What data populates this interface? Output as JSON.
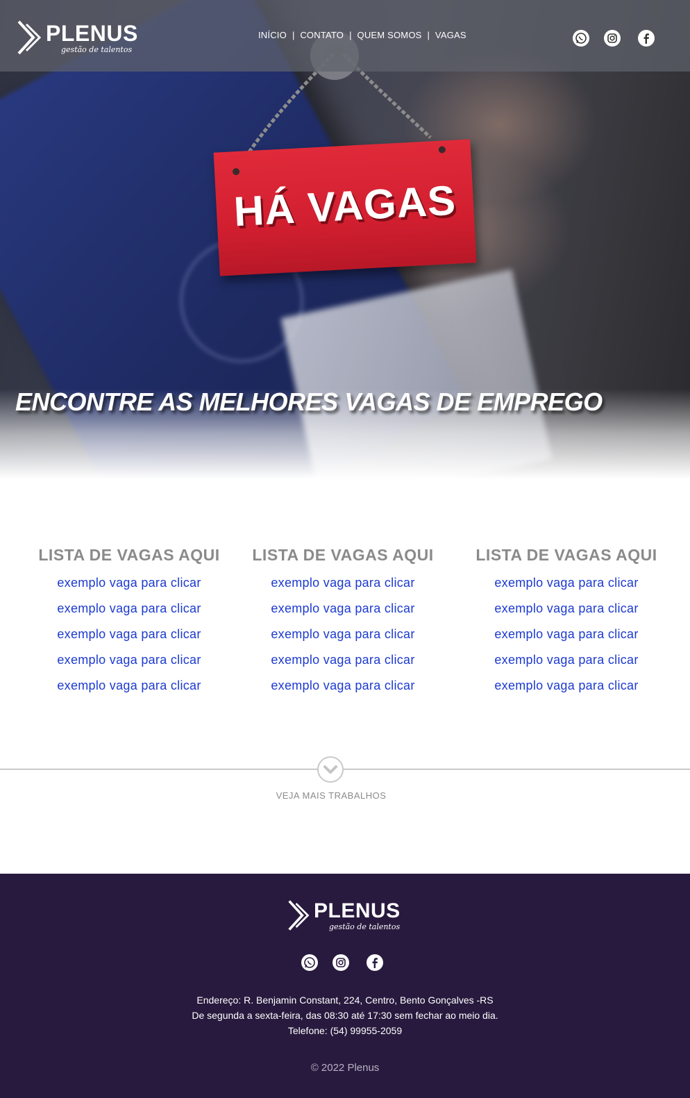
{
  "brand": {
    "name": "PLENUS",
    "tagline": "gestão de talentos"
  },
  "nav": {
    "items": [
      "INÍCIO",
      "CONTATO",
      "QUEM SOMOS",
      "VAGAS"
    ],
    "separator": "|"
  },
  "social": [
    "whatsapp-icon",
    "instagram-icon",
    "facebook-icon"
  ],
  "hero": {
    "sign_text": "HÁ VAGAS",
    "headline": "ENCONTRE AS MELHORES VAGAS DE EMPREGO"
  },
  "jobs": {
    "columns": [
      {
        "title": "LISTA DE VAGAS AQUI",
        "items": [
          "exemplo vaga para clicar",
          "exemplo vaga para clicar",
          "exemplo vaga para clicar",
          "exemplo vaga para clicar",
          "exemplo vaga para clicar"
        ]
      },
      {
        "title": "LISTA DE VAGAS AQUI",
        "items": [
          "exemplo vaga para clicar",
          "exemplo vaga para clicar",
          "exemplo vaga para clicar",
          "exemplo vaga para clicar",
          "exemplo vaga para clicar"
        ]
      },
      {
        "title": "LISTA DE VAGAS AQUI",
        "items": [
          "exemplo vaga para clicar",
          "exemplo vaga para clicar",
          "exemplo vaga para clicar",
          "exemplo vaga para clicar",
          "exemplo vaga para clicar"
        ]
      }
    ],
    "more_label": "VEJA MAIS TRABALHOS"
  },
  "footer": {
    "address": "Endereço: R. Benjamin Constant, 224, Centro, Bento Gonçalves -RS",
    "hours": "De segunda a sexta-feira, das 08:30 até 17:30 sem fechar ao meio dia.",
    "phone": "Telefone: (54) 99955-2059",
    "copyright": "© 2022 Plenus"
  },
  "colors": {
    "footer_bg": "#281a3e",
    "link": "#1c3ad0",
    "sign_red": "#d21f30",
    "muted_text": "#8a8a8a"
  }
}
